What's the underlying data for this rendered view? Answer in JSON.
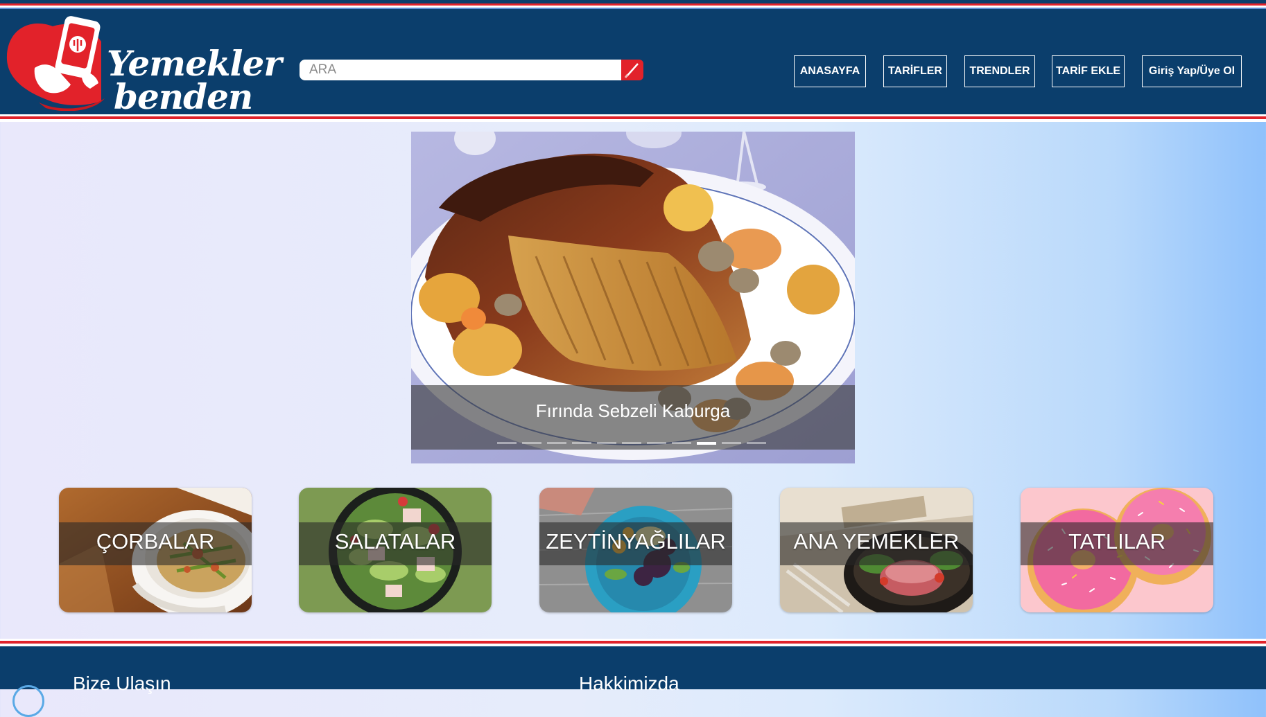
{
  "header": {
    "logo_text_line1": "Yemekler",
    "logo_text_line2": "benden",
    "search": {
      "placeholder": "ARA"
    },
    "nav": [
      {
        "label": "ANASAYFA"
      },
      {
        "label": "TARİFLER"
      },
      {
        "label": "TRENDLER"
      },
      {
        "label": "TARİF EKLE"
      },
      {
        "label": "Giriş Yap/Üye Ol"
      }
    ]
  },
  "carousel": {
    "caption": "Fırında Sebzeli Kaburga",
    "slide_count": 11,
    "active_index": 8
  },
  "categories": [
    {
      "label": "ÇORBALAR"
    },
    {
      "label": "SALATALAR"
    },
    {
      "label": "ZEYTİNYAĞLILAR"
    },
    {
      "label": "ANA YEMEKLER"
    },
    {
      "label": "TATLILAR"
    }
  ],
  "footer": {
    "contact_title": "Bize Ulaşın",
    "about_title": "Hakkimizda"
  },
  "colors": {
    "header_bg": "#0b3e6c",
    "accent_red": "#e2222a",
    "white": "#ffffff"
  }
}
